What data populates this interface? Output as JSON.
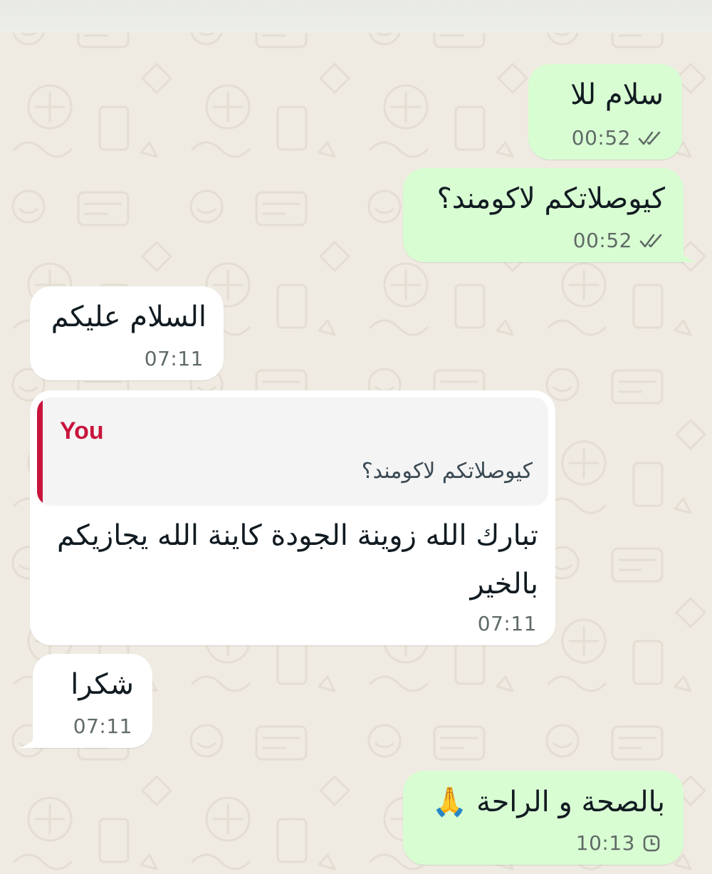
{
  "messages": [
    {
      "direction": "outgoing",
      "text": "سلام للا",
      "time": "00:52",
      "status_icon": "double-check-icon"
    },
    {
      "direction": "outgoing",
      "text": "كيوصلاتكم لاكومند؟",
      "time": "00:52",
      "status_icon": "double-check-icon"
    },
    {
      "direction": "incoming",
      "text": "السلام عليكم",
      "time": "07:11"
    },
    {
      "direction": "incoming",
      "quoted": {
        "author": "You",
        "text": "كيوصلاتكم لاكومند؟"
      },
      "text": "تبارك الله زوينة الجودة كاينة الله يجازيكم بالخير",
      "time": "07:11"
    },
    {
      "direction": "incoming",
      "text": "شكرا",
      "time": "07:11"
    },
    {
      "direction": "outgoing",
      "text": "بالصحة و الراحة 🙏",
      "time": "10:13",
      "status_icon": "pending-clock-icon"
    }
  ],
  "colors": {
    "outgoing_bubble": "#d9fdd3",
    "incoming_bubble": "#ffffff",
    "chat_background": "#efeae2",
    "quote_accent": "#c8143c",
    "tick_color": "#5f6b66"
  }
}
